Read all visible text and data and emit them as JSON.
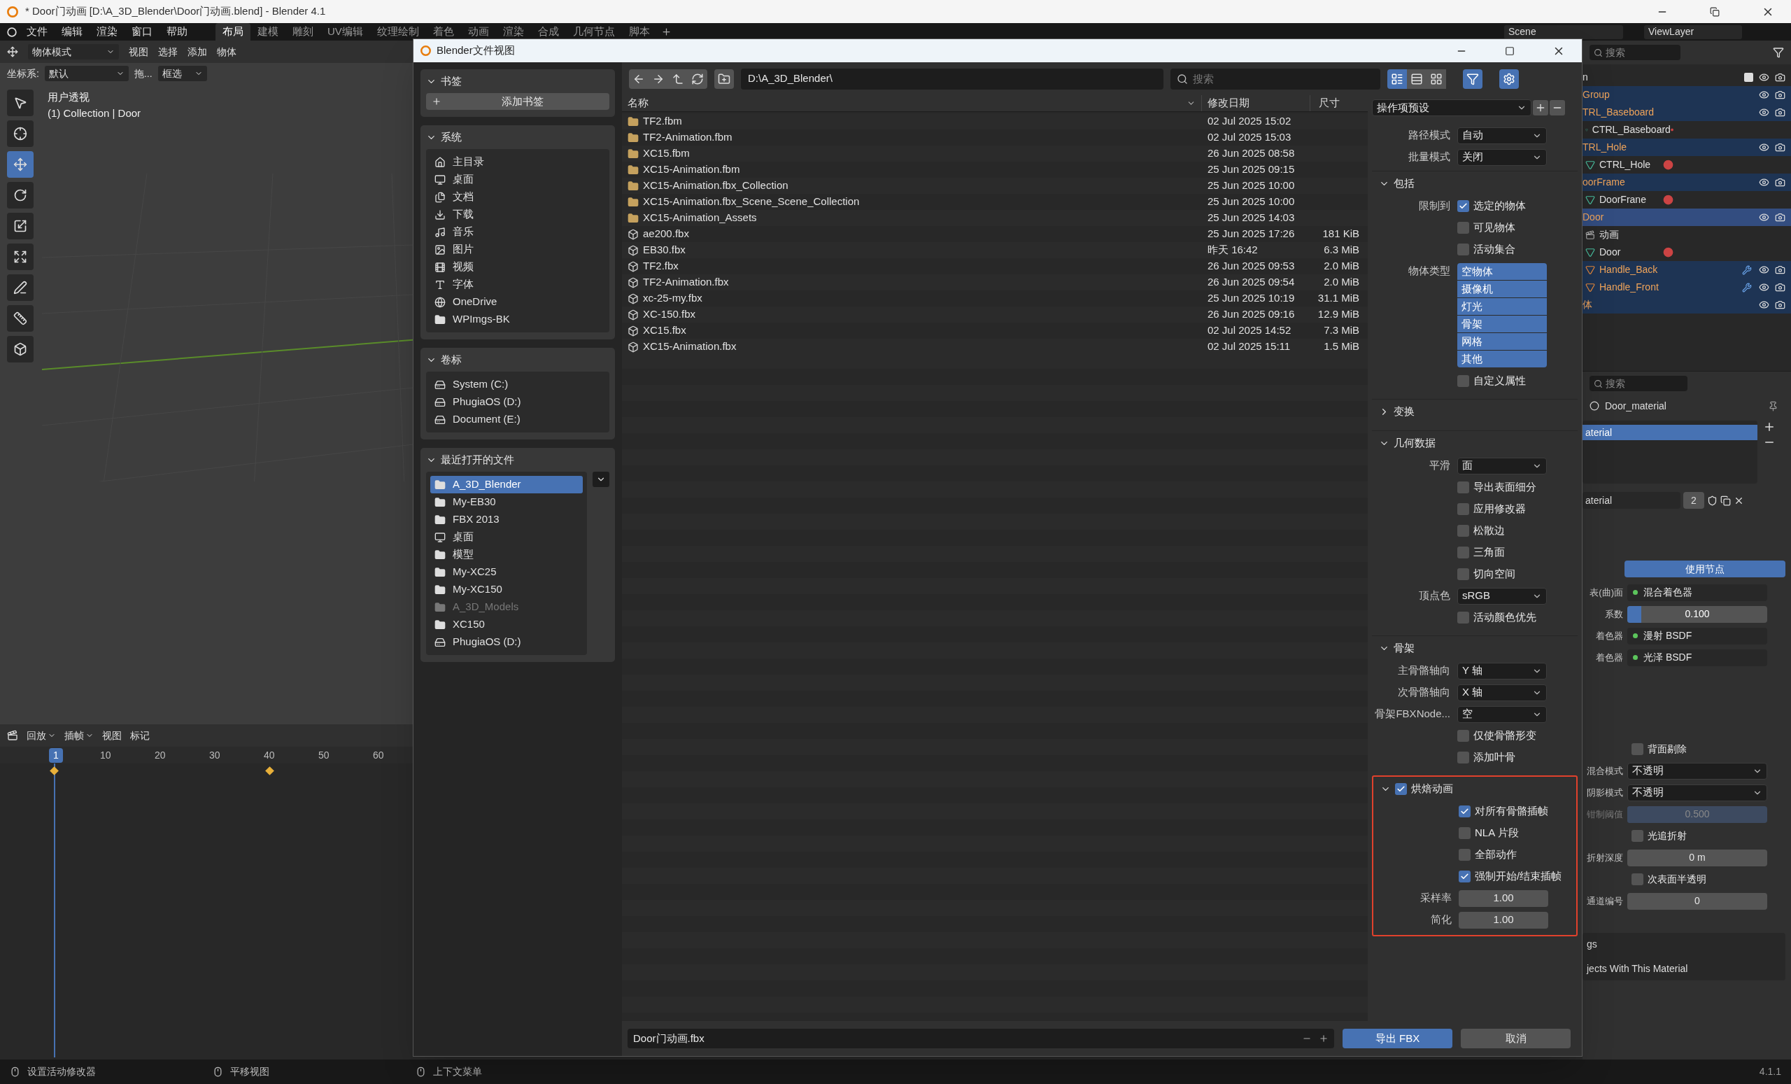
{
  "title_bar": {
    "title": "* Door门动画 [D:\\A_3D_Blender\\Door门动画.blend] - Blender 4.1"
  },
  "menu": [
    "文件",
    "编辑",
    "渲染",
    "窗口",
    "帮助"
  ],
  "workspaces": [
    {
      "label": "布局",
      "selected": true
    },
    {
      "label": "建模",
      "selected": false
    },
    {
      "label": "雕刻",
      "selected": false
    },
    {
      "label": "UV编辑",
      "selected": false
    },
    {
      "label": "纹理绘制",
      "selected": false
    },
    {
      "label": "着色",
      "selected": false
    },
    {
      "label": "动画",
      "selected": false
    },
    {
      "label": "渲染",
      "selected": false
    },
    {
      "label": "合成",
      "selected": false
    },
    {
      "label": "几何节点",
      "selected": false
    },
    {
      "label": "脚本",
      "selected": false
    }
  ],
  "scene": "Scene",
  "view_layer": "ViewLayer",
  "viewport": {
    "mode": "物体模式",
    "menus": [
      "视图",
      "选择",
      "添加",
      "物体"
    ],
    "orientation_label": "坐标系:",
    "orientation": "默认",
    "drag": "拖...",
    "select_mode": "框选",
    "view_name": "用户透视",
    "context": "(1) Collection | Door",
    "tools": [
      {
        "kind": "select",
        "selected": false
      },
      {
        "kind": "cursor",
        "selected": false
      },
      {
        "kind": "move",
        "selected": true
      },
      {
        "kind": "rotate",
        "selected": false
      },
      {
        "kind": "scale",
        "selected": false
      },
      {
        "kind": "transform",
        "selected": false
      },
      {
        "kind": "annotate",
        "selected": false
      },
      {
        "kind": "measure",
        "selected": false
      },
      {
        "kind": "add",
        "selected": false
      }
    ]
  },
  "timeline": {
    "menus": [
      {
        "label": "回放",
        "dropdown": true
      },
      {
        "label": "插帧",
        "dropdown": true
      },
      {
        "label": "视图",
        "dropdown": false
      },
      {
        "label": "标记",
        "dropdown": false
      }
    ],
    "frames": [
      {
        "label": "1",
        "selected": true
      },
      {
        "label": "10",
        "selected": false
      },
      {
        "label": "20",
        "selected": false
      },
      {
        "label": "30",
        "selected": false
      },
      {
        "label": "40",
        "selected": false
      },
      {
        "label": "50",
        "selected": false
      },
      {
        "label": "60",
        "selected": false
      }
    ]
  },
  "outliner": {
    "search": "搜索",
    "items": [
      {
        "label": "n",
        "kind": "collection",
        "selected": false,
        "active": false
      },
      {
        "label": "Group",
        "kind": "object",
        "selected": true,
        "active": false
      },
      {
        "label": "TRL_Baseboard",
        "kind": "object",
        "selected": true,
        "active": false,
        "children": [
          {
            "label": "CTRL_Baseboard",
            "kind": "data",
            "selected": false,
            "active": false
          }
        ]
      },
      {
        "label": "TRL_Hole",
        "kind": "object",
        "selected": true,
        "active": false,
        "children": [
          {
            "label": "CTRL_Hole",
            "kind": "data",
            "selected": false,
            "active": false
          }
        ]
      },
      {
        "label": "oorFrame",
        "kind": "object",
        "selected": true,
        "active": false,
        "children": [
          {
            "label": "DoorFrane",
            "kind": "data",
            "selected": false,
            "active": false
          }
        ]
      },
      {
        "label": "Door",
        "kind": "object",
        "selected": true,
        "active": true,
        "children": [
          {
            "label": "动画",
            "kind": "action",
            "selected": false,
            "active": false
          },
          {
            "label": "Door",
            "kind": "data",
            "selected": false,
            "active": false
          },
          {
            "label": "Handle_Back",
            "kind": "object",
            "selected": true,
            "active": false
          },
          {
            "label": "Handle_Front",
            "kind": "object",
            "selected": true,
            "active": false
          }
        ]
      },
      {
        "label": "体",
        "kind": "object",
        "selected": true,
        "active": false
      }
    ]
  },
  "properties": {
    "search": "搜索",
    "material": "Door_material",
    "slots": [
      {
        "label": "aterial",
        "selected": true
      }
    ],
    "slot_name": "aterial",
    "users": "2",
    "use_nodes": "使用节点",
    "surface": [
      {
        "kind": "socket",
        "label": "表(曲)面",
        "value": "混合着色器"
      },
      {
        "kind": "slider",
        "label": "系数",
        "value": "0.100",
        "level": 0.1
      },
      {
        "kind": "socket",
        "label": "着色器",
        "value": "漫射 BSDF"
      },
      {
        "kind": "socket",
        "label": "着色器",
        "value": "光泽 BSDF"
      }
    ],
    "settings": [
      {
        "kind": "checkbox",
        "text": "背面剔除",
        "checked": false,
        "disabled": false
      },
      {
        "kind": "dropdown",
        "label": "混合模式",
        "value": "不透明",
        "disabled": false
      },
      {
        "kind": "dropdown",
        "label": "阴影模式",
        "value": "不透明",
        "disabled": false
      },
      {
        "kind": "slider",
        "label": "钳制阈值",
        "value": "0.500",
        "level": 0.5,
        "disabled": true
      },
      {
        "kind": "checkbox",
        "text": "光追折射",
        "checked": false,
        "disabled": false
      },
      {
        "kind": "number",
        "label": "折射深度",
        "value": "0 m",
        "disabled": false
      },
      {
        "kind": "checkbox",
        "text": "次表面半透明",
        "checked": false,
        "disabled": false
      },
      {
        "kind": "number",
        "label": "通道编号",
        "value": "0",
        "disabled": false
      }
    ],
    "footer": [
      "gs",
      "jects With This Material"
    ]
  },
  "status_bar": {
    "hints": [
      "设置活动修改器",
      "平移视图",
      "上下文菜单"
    ],
    "version": "4.1.1"
  },
  "dialog": {
    "title": "Blender文件视图",
    "panels": [
      {
        "title": "书签",
        "expanded": true,
        "action": "添加书签"
      },
      {
        "title": "系统",
        "expanded": true,
        "items": [
          {
            "label": "主目录",
            "kind": "home",
            "selected": false,
            "disabled": false
          },
          {
            "label": "桌面",
            "kind": "desktop",
            "selected": false,
            "disabled": false
          },
          {
            "label": "文档",
            "kind": "documents",
            "selected": false,
            "disabled": false
          },
          {
            "label": "下载",
            "kind": "download",
            "selected": false,
            "disabled": false
          },
          {
            "label": "音乐",
            "kind": "music",
            "selected": false,
            "disabled": false
          },
          {
            "label": "图片",
            "kind": "pictures",
            "selected": false,
            "disabled": false
          },
          {
            "label": "视频",
            "kind": "video",
            "selected": false,
            "disabled": false
          },
          {
            "label": "字体",
            "kind": "fonts",
            "selected": false,
            "disabled": false
          },
          {
            "label": "OneDrive",
            "kind": "cloud",
            "selected": false,
            "disabled": false
          },
          {
            "label": "WPImgs-BK",
            "kind": "folder",
            "selected": false,
            "disabled": false
          }
        ]
      },
      {
        "title": "卷标",
        "expanded": true,
        "items": [
          {
            "label": "System (C:)",
            "kind": "drive",
            "selected": false,
            "disabled": false
          },
          {
            "label": "PhugiaOS (D:)",
            "kind": "drive",
            "selected": false,
            "disabled": false
          },
          {
            "label": "Document (E:)",
            "kind": "drive",
            "selected": false,
            "disabled": false
          }
        ]
      },
      {
        "title": "最近打开的文件",
        "expanded": true,
        "items": [
          {
            "label": "A_3D_Blender",
            "kind": "folder",
            "selected": true,
            "disabled": false
          },
          {
            "label": "My-EB30",
            "kind": "folder",
            "selected": false,
            "disabled": false
          },
          {
            "label": "FBX 2013",
            "kind": "folder",
            "selected": false,
            "disabled": false
          },
          {
            "label": "桌面",
            "kind": "desktop",
            "selected": false,
            "disabled": false
          },
          {
            "label": "模型",
            "kind": "folder",
            "selected": false,
            "disabled": false
          },
          {
            "label": "My-XC25",
            "kind": "folder",
            "selected": false,
            "disabled": false
          },
          {
            "label": "My-XC150",
            "kind": "folder",
            "selected": false,
            "disabled": false
          },
          {
            "label": "A_3D_Models",
            "kind": "folder",
            "selected": false,
            "disabled": true
          },
          {
            "label": "XC150",
            "kind": "folder",
            "selected": false,
            "disabled": false
          },
          {
            "label": "PhugiaOS (D:)",
            "kind": "drive",
            "selected": false,
            "disabled": false
          }
        ]
      }
    ],
    "path": "D:\\A_3D_Blender\\",
    "search": {
      "placeholder": "搜索"
    },
    "columns": [
      "名称",
      "修改日期",
      "尺寸"
    ],
    "files": [
      {
        "name": "TF2.fbm",
        "kind": "folder",
        "date": "02 Jul 2025 15:02"
      },
      {
        "name": "TF2-Animation.fbm",
        "kind": "folder",
        "date": "02 Jul 2025 15:03"
      },
      {
        "name": "XC15.fbm",
        "kind": "folder",
        "date": "26 Jun 2025 08:58"
      },
      {
        "name": "XC15-Animation.fbm",
        "kind": "folder",
        "date": "25 Jun 2025 09:15"
      },
      {
        "name": "XC15-Animation.fbx_Collection",
        "kind": "folder",
        "date": "25 Jun 2025 10:00"
      },
      {
        "name": "XC15-Animation.fbx_Scene_Scene_Collection",
        "kind": "folder",
        "date": "25 Jun 2025 10:00"
      },
      {
        "name": "XC15-Animation_Assets",
        "kind": "folder",
        "date": "25 Jun 2025 14:03"
      },
      {
        "name": "ae200.fbx",
        "kind": "file",
        "date": "25 Jun 2025 17:26",
        "size": "181 KiB"
      },
      {
        "name": "EB30.fbx",
        "kind": "file",
        "date": "昨天 16:42",
        "size": "6.3 MiB"
      },
      {
        "name": "TF2.fbx",
        "kind": "file",
        "date": "26 Jun 2025 09:53",
        "size": "2.0 MiB"
      },
      {
        "name": "TF2-Animation.fbx",
        "kind": "file",
        "date": "26 Jun 2025 09:54",
        "size": "2.0 MiB"
      },
      {
        "name": "xc-25-my.fbx",
        "kind": "file",
        "date": "25 Jun 2025 10:19",
        "size": "31.1 MiB"
      },
      {
        "name": "XC-150.fbx",
        "kind": "file",
        "date": "26 Jun 2025 09:16",
        "size": "12.9 MiB"
      },
      {
        "name": "XC15.fbx",
        "kind": "file",
        "date": "02 Jul 2025 14:52",
        "size": "7.3 MiB"
      },
      {
        "name": "XC15-Animation.fbx",
        "kind": "file",
        "date": "02 Jul 2025 15:11",
        "size": "1.5 MiB"
      }
    ],
    "options": {
      "preset": "操作项预设",
      "rows": [
        {
          "kind": "dropdown",
          "label": "路径模式",
          "value": "自动"
        },
        {
          "kind": "dropdown",
          "label": "批量模式",
          "value": "关闭"
        }
      ],
      "sections": [
        {
          "title": "包括",
          "expanded": true,
          "highlighted": false,
          "rows": [
            {
              "kind": "checkbox",
              "label": "限制到",
              "text": "选定的物体",
              "checked": true
            },
            {
              "kind": "checkbox",
              "text": "可见物体",
              "checked": false
            },
            {
              "kind": "checkbox",
              "text": "活动集合",
              "checked": false
            },
            {
              "kind": "list",
              "label": "物体类型",
              "items": [
                {
                  "text": "空物体",
                  "selected": true
                },
                {
                  "text": "摄像机",
                  "selected": true
                },
                {
                  "text": "灯光",
                  "selected": true
                },
                {
                  "text": "骨架",
                  "selected": true
                },
                {
                  "text": "网格",
                  "selected": true
                },
                {
                  "text": "其他",
                  "selected": true
                }
              ]
            },
            {
              "kind": "checkbox",
              "text": "自定义属性",
              "checked": false
            }
          ]
        },
        {
          "title": "变换",
          "expanded": false,
          "highlighted": false
        },
        {
          "title": "几何数据",
          "expanded": true,
          "highlighted": false,
          "rows": [
            {
              "kind": "dropdown",
              "label": "平滑",
              "value": "面"
            },
            {
              "kind": "checkbox",
              "text": "导出表面细分",
              "checked": false
            },
            {
              "kind": "checkbox",
              "text": "应用修改器",
              "checked": false
            },
            {
              "kind": "checkbox",
              "text": "松散边",
              "checked": false
            },
            {
              "kind": "checkbox",
              "text": "三角面",
              "checked": false
            },
            {
              "kind": "checkbox",
              "text": "切向空间",
              "checked": false
            },
            {
              "kind": "dropdown",
              "label": "顶点色",
              "value": "sRGB"
            },
            {
              "kind": "checkbox",
              "text": "活动颜色优先",
              "checked": false
            }
          ]
        },
        {
          "title": "骨架",
          "expanded": true,
          "highlighted": false,
          "rows": [
            {
              "kind": "dropdown",
              "label": "主骨骼轴向",
              "value": "Y 轴"
            },
            {
              "kind": "dropdown",
              "label": "次骨骼轴向",
              "value": "X 轴"
            },
            {
              "kind": "dropdown",
              "label": "骨架FBXNode...",
              "value": "空"
            },
            {
              "kind": "checkbox",
              "text": "仅使骨骼形变",
              "checked": false
            },
            {
              "kind": "checkbox",
              "text": "添加叶骨",
              "checked": false
            }
          ]
        },
        {
          "title": "烘焙动画",
          "expanded": true,
          "highlighted": true,
          "checked": true,
          "rows": [
            {
              "kind": "checkbox",
              "text": "对所有骨骼插帧",
              "checked": true
            },
            {
              "kind": "checkbox",
              "text": "NLA 片段",
              "checked": false
            },
            {
              "kind": "checkbox",
              "text": "全部动作",
              "checked": false
            },
            {
              "kind": "checkbox",
              "text": "强制开始/结束插帧",
              "checked": true
            },
            {
              "kind": "number",
              "label": "采样率",
              "value": "1.00"
            },
            {
              "kind": "number",
              "label": "简化",
              "value": "1.00"
            }
          ]
        }
      ]
    },
    "filename": "Door门动画.fbx",
    "confirm": "导出 FBX",
    "cancel": "取消"
  }
}
